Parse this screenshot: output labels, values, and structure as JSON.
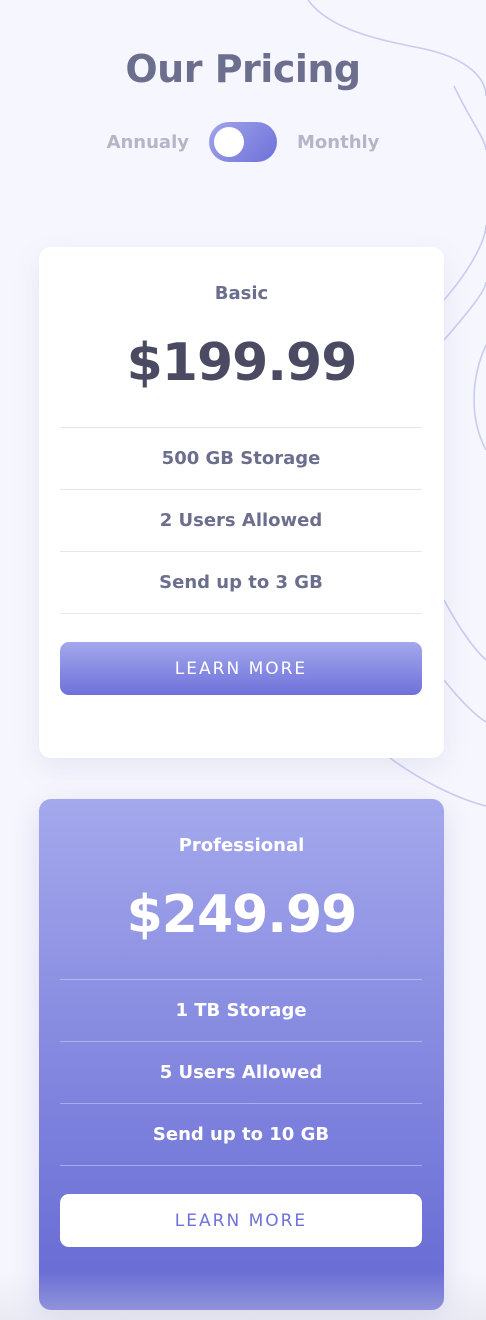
{
  "page": {
    "title": "Our Pricing"
  },
  "billing_toggle": {
    "left_label": "Annualy",
    "right_label": "Monthly",
    "state": "annually"
  },
  "plans": [
    {
      "name": "Basic",
      "price": "$199.99",
      "features": [
        "500 GB Storage",
        "2 Users Allowed",
        "Send up to 3 GB"
      ],
      "button_label": "LEARN MORE"
    },
    {
      "name": "Professional",
      "price": "$249.99",
      "features": [
        "1 TB Storage",
        "5 Users Allowed",
        "Send up to 10 GB"
      ],
      "button_label": "LEARN MORE"
    }
  ],
  "colors": {
    "background": "#f6f6fe",
    "accent_light": "#a4a8ec",
    "accent_dark": "#6569d3",
    "heading": "#6c6e8e",
    "price_dark": "#4a4b63"
  }
}
